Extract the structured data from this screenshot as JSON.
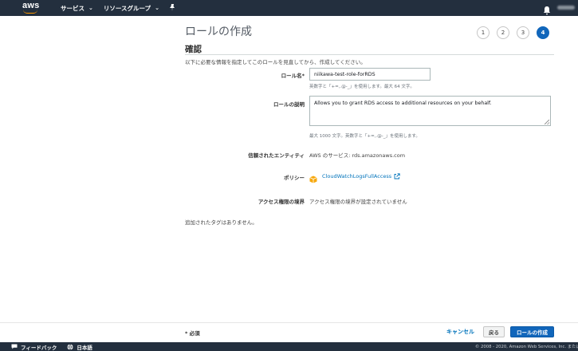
{
  "nav": {
    "logo_text": "aws",
    "services_label": "サービス",
    "resource_groups_label": "リソースグループ"
  },
  "header": {
    "title": "ロールの作成",
    "steps": [
      "1",
      "2",
      "3",
      "4"
    ],
    "active_step": "4"
  },
  "section": {
    "title": "確認",
    "intro": "以下に必要な情報を指定してこのロールを見直してから、作成してください。"
  },
  "form": {
    "role_name_label": "ロール名*",
    "role_name_value": "niikawa-test-role-forRDS",
    "role_name_hint": "英数字と「+=,.@-_」を使用します。最大 64 文字。",
    "description_label": "ロールの説明",
    "description_value": "Allows you to grant RDS access to additional resources on your behalf.",
    "description_hint": "最大 1000 文字。英数字と「+=,.@-_」を使用します。",
    "trusted_entity_label": "信頼されたエンティティ",
    "trusted_entity_value": "AWS のサービス: rds.amazonaws.com",
    "policy_label": "ポリシー",
    "policy_value": "CloudWatchLogsFullAccess",
    "boundary_label": "アクセス権限の境界",
    "boundary_value": "アクセス権限の境界が設定されていません",
    "no_tags": "追加されたタグはありません。"
  },
  "actions": {
    "required_note": "* 必須",
    "cancel_label": "キャンセル",
    "back_label": "戻る",
    "create_label": "ロールの作成"
  },
  "footer": {
    "feedback_label": "フィードバック",
    "language_label": "日本語",
    "copyright": "© 2008 - 2020, Amazon Web Services, Inc. またはそ"
  },
  "colors": {
    "nav_bg": "#232f3e",
    "primary": "#1166bb",
    "link": "#0073bb",
    "logo_accent": "#ff9900",
    "policy_icon": "#f7a80d"
  }
}
